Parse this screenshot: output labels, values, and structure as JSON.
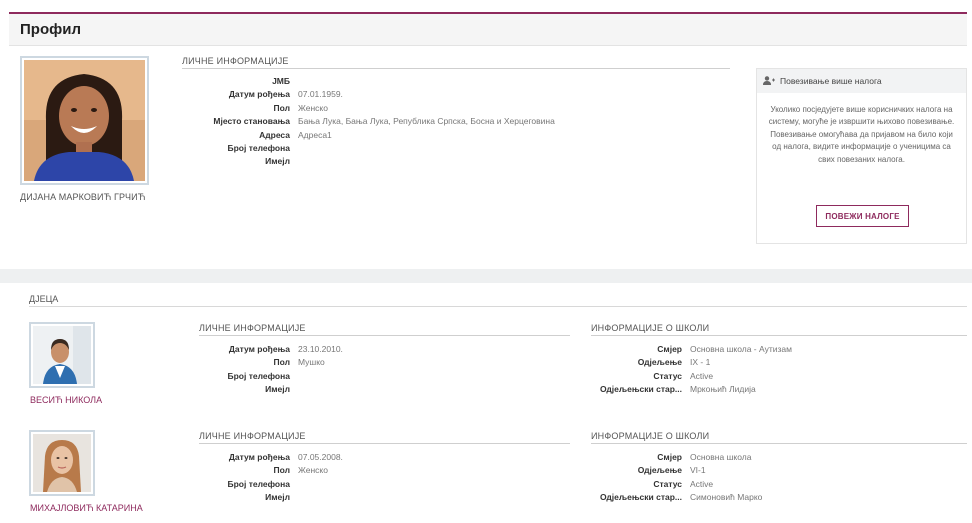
{
  "page": {
    "title": "Профил"
  },
  "profile": {
    "name": "ДИЈАНА МАРКОВИЋ ГРЧИЋ",
    "section_title": "ЛИЧНЕ ИНФОРМАЦИЈЕ",
    "fields": [
      {
        "label": "ЈМБ",
        "value": ""
      },
      {
        "label": "Датум рођења",
        "value": "07.01.1959."
      },
      {
        "label": "Пол",
        "value": "Женско"
      },
      {
        "label": "Мјесто становања",
        "value": "Бања Лука, Бања Лука, Република Српска, Босна и Херцеговина"
      },
      {
        "label": "Адреса",
        "value": "Адреса1"
      },
      {
        "label": "Број телефона",
        "value": ""
      },
      {
        "label": "Имејл",
        "value": ""
      }
    ]
  },
  "link_accounts": {
    "title": "Повезивање више налога",
    "icon": "link-users-icon",
    "text": "Уколико посједујете више корисничких налога на систему, могуће је извршити њихово повезивање. Повезивање омогућава да пријавом на било који од налога, видите информације о ученицима са свих повезаних налога.",
    "button": "ПОВЕЖИ НАЛОГЕ"
  },
  "children": {
    "title": "ДЈЕЦА",
    "personal_title": "ЛИЧНЕ ИНФОРМАЦИЈЕ",
    "school_title": "ИНФОРМАЦИЈЕ О ШКОЛИ",
    "items": [
      {
        "name": "ВЕСИЋ НИКОЛА",
        "personal": [
          {
            "label": "Датум рођења",
            "value": "23.10.2010."
          },
          {
            "label": "Пол",
            "value": "Мушко"
          },
          {
            "label": "Број телефона",
            "value": ""
          },
          {
            "label": "Имејл",
            "value": ""
          }
        ],
        "school": [
          {
            "label": "Смјер",
            "value": "Основна школа - Аутизам"
          },
          {
            "label": "Одјељење",
            "value": "IX - 1"
          },
          {
            "label": "Статус",
            "value": "Active"
          },
          {
            "label": "Одјељењски стар...",
            "value": "Мркоњић Лидија"
          }
        ]
      },
      {
        "name": "МИХАЈЛОВИЋ КАТАРИНА",
        "personal": [
          {
            "label": "Датум рођења",
            "value": "07.05.2008."
          },
          {
            "label": "Пол",
            "value": "Женско"
          },
          {
            "label": "Број телефона",
            "value": ""
          },
          {
            "label": "Имејл",
            "value": ""
          }
        ],
        "school": [
          {
            "label": "Смјер",
            "value": "Основна школа"
          },
          {
            "label": "Одјељење",
            "value": "VI-1"
          },
          {
            "label": "Статус",
            "value": "Active"
          },
          {
            "label": "Одјељењски стар...",
            "value": "Симоновић Марко"
          }
        ]
      }
    ]
  },
  "colors": {
    "accent": "#8e2a5d",
    "band": "#eef0f1"
  }
}
